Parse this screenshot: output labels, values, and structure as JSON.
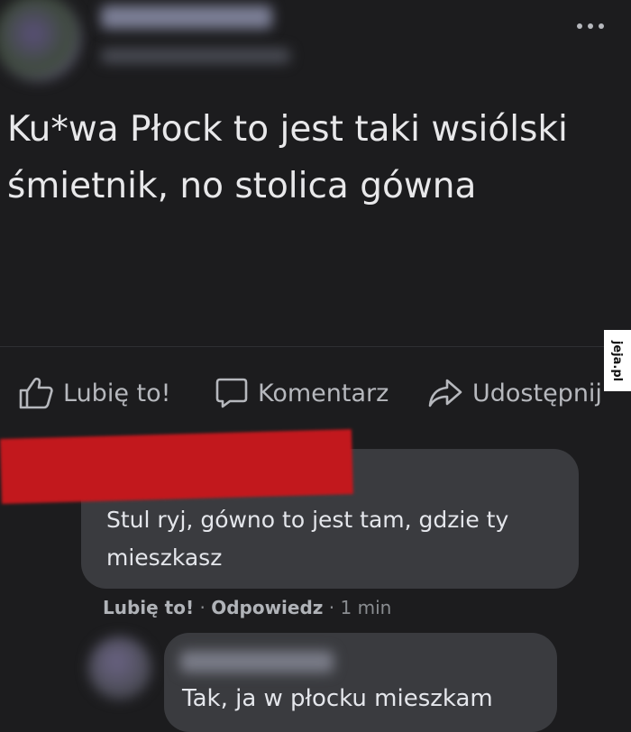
{
  "post": {
    "text": "Ku*wa Płock to jest taki wsiólski śmietnik, no stolica gówna"
  },
  "actions": {
    "like_label": "Lubię to!",
    "comment_label": "Komentarz",
    "share_label": "Udostępnij"
  },
  "watermark": {
    "text": "jeja.pl"
  },
  "comment": {
    "text": "Stul ryj, gówno to jest tam, gdzie ty mieszkasz",
    "like_link": "Lubię to!",
    "reply_link": "Odpowiedz",
    "separator": "·",
    "time": "1 min"
  },
  "reply": {
    "text": "Tak, ja w płocku mieszkam"
  },
  "icons": {
    "more": "more-dots-icon",
    "like": "thumbs-up-icon",
    "comment": "speech-bubble-icon",
    "share": "share-arrow-icon"
  },
  "colors": {
    "background": "#1c1c1e",
    "bubble": "#3a3b3f",
    "redaction": "#c2181d"
  }
}
